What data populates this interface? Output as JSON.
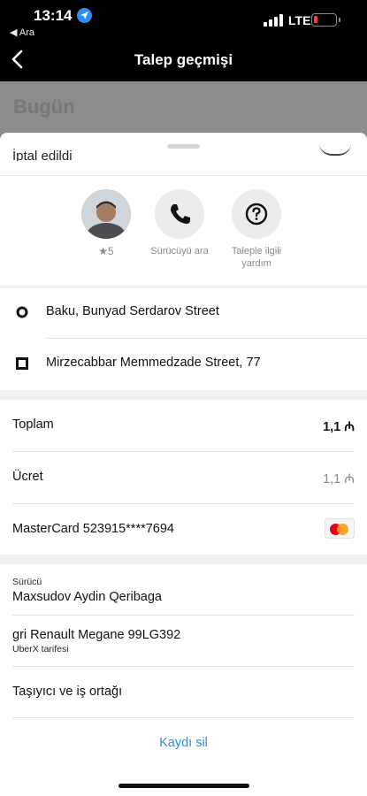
{
  "status_bar": {
    "time": "13:14",
    "back_app": "◀ Ara",
    "network": "LTE",
    "battery_color": "#ff3b30"
  },
  "nav": {
    "title": "Talep geçmişi",
    "back_icon": "chevron-left-icon"
  },
  "background": {
    "heading": "Bugün"
  },
  "sheet": {
    "peek_text": "İptal edildi",
    "driver_rating": "★5",
    "actions": [
      {
        "label": "Sürücüyü ara",
        "icon": "phone-icon"
      },
      {
        "label": "Taleple ilgili yardım",
        "icon": "help-icon"
      }
    ],
    "route": [
      {
        "text": "Baku, Bunyad Serdarov Street",
        "marker": "origin-circle-icon"
      },
      {
        "text": "Mirzecabbar Memmedzade Street, 77",
        "marker": "destination-square-icon"
      }
    ],
    "summary": {
      "total_label": "Toplam",
      "total_value": "1,1 ₼",
      "fee_label": "Ücret",
      "fee_value": "1,1 ₼",
      "payment_label": "MasterCard 523915****7694"
    },
    "driver": {
      "section_label": "Sürücü",
      "name": "Maxsudov Aydin Qeribaga",
      "vehicle": "gri Renault Megane 99LG392",
      "tariff": "UberX tarifesi",
      "partner_label": "Taşıyıcı ve iş ortağı"
    },
    "delete_label": "Kaydı sil"
  },
  "colors": {
    "accent_link": "#2b8fd6",
    "mastercard_red": "#eb001b",
    "mastercard_orange": "#f79e1b"
  }
}
